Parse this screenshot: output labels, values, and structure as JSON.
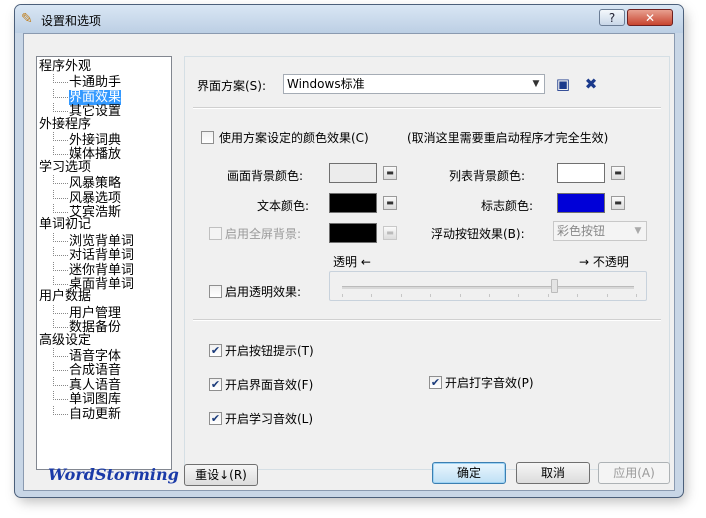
{
  "window": {
    "title": "设置和选项",
    "help_label": "?",
    "close_label": "✕"
  },
  "tree": {
    "items": [
      {
        "label": "程序外观",
        "level": 0
      },
      {
        "label": "卡通助手",
        "level": 1
      },
      {
        "label": "界面效果",
        "level": 1,
        "selected": true
      },
      {
        "label": "其它设置",
        "level": 1
      },
      {
        "label": "外接程序",
        "level": 0
      },
      {
        "label": "外接词典",
        "level": 1
      },
      {
        "label": "媒体播放",
        "level": 1
      },
      {
        "label": "学习选项",
        "level": 0
      },
      {
        "label": "风暴策略",
        "level": 1
      },
      {
        "label": "风暴选项",
        "level": 1
      },
      {
        "label": "艾宾浩斯",
        "level": 1
      },
      {
        "label": "单词初记",
        "level": 0
      },
      {
        "label": "浏览背单词",
        "level": 1
      },
      {
        "label": "对话背单词",
        "level": 1
      },
      {
        "label": "迷你背单词",
        "level": 1
      },
      {
        "label": "桌面背单词",
        "level": 1
      },
      {
        "label": "用户数据",
        "level": 0
      },
      {
        "label": "用户管理",
        "level": 1
      },
      {
        "label": "数据备份",
        "level": 1
      },
      {
        "label": "高级设定",
        "level": 0
      },
      {
        "label": "语音字体",
        "level": 1
      },
      {
        "label": "合成语音",
        "level": 1
      },
      {
        "label": "真人语音",
        "level": 1
      },
      {
        "label": "单词图库",
        "level": 1
      },
      {
        "label": "自动更新",
        "level": 1
      }
    ]
  },
  "scheme": {
    "label": "界面方案(S):",
    "value": "Windows标准"
  },
  "use_scheme_colors": {
    "label": "使用方案设定的颜色效果(C)",
    "note": "(取消这里需要重启动程序才完全生效)",
    "checked": false
  },
  "colors": {
    "canvas_bg_label": "画面背景颜色:",
    "canvas_bg_color": "#ececec",
    "list_bg_label": "列表背景颜色:",
    "list_bg_color": "#ffffff",
    "text_label": "文本颜色:",
    "text_color": "#000000",
    "marker_label": "标志颜色:",
    "marker_color": "#0000d8",
    "fullscreen_bg_label": "启用全屏背景:",
    "fullscreen_bg_color": "#000000"
  },
  "float_button": {
    "label": "浮动按钮效果(B):",
    "value": "彩色按钮"
  },
  "transparency": {
    "label": "启用透明效果:",
    "left_label": "透明 ←",
    "right_label": "→ 不透明",
    "level": 0.72
  },
  "options": {
    "button_tips": {
      "label": "开启按钮提示(T)",
      "checked": true
    },
    "ui_sound": {
      "label": "开启界面音效(F)",
      "checked": true
    },
    "typing_sound": {
      "label": "开启打字音效(P)",
      "checked": true
    },
    "study_sound": {
      "label": "开启学习音效(L)",
      "checked": true
    }
  },
  "footer": {
    "brand": "WordStorming",
    "reset_label": "重设↓(R)",
    "ok_label": "确定",
    "cancel_label": "取消",
    "apply_label": "应用(A)"
  }
}
